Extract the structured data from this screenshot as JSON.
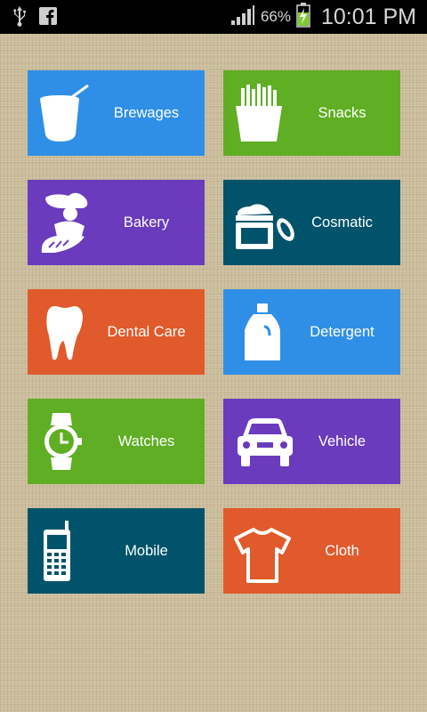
{
  "status_bar": {
    "battery_percent": "66%",
    "time": "10:01 PM",
    "icons": [
      "usb-icon",
      "facebook-icon",
      "signal-icon",
      "battery-charging-icon"
    ]
  },
  "categories": [
    {
      "label": "Brewages",
      "icon": "cup-icon",
      "color": "#2f8fe6"
    },
    {
      "label": "Snacks",
      "icon": "fries-icon",
      "color": "#5fae23"
    },
    {
      "label": "Bakery",
      "icon": "baker-icon",
      "color": "#6a3bbd"
    },
    {
      "label": "Cosmatic",
      "icon": "cream-jar-icon",
      "color": "#00536a"
    },
    {
      "label": "Dental Care",
      "icon": "tooth-icon",
      "color": "#e05a2b"
    },
    {
      "label": "Detergent",
      "icon": "detergent-bottle-icon",
      "color": "#2f8fe6"
    },
    {
      "label": "Watches",
      "icon": "watch-icon",
      "color": "#5fae23"
    },
    {
      "label": "Vehicle",
      "icon": "car-icon",
      "color": "#6a3bbd"
    },
    {
      "label": "Mobile",
      "icon": "mobile-phone-icon",
      "color": "#00536a"
    },
    {
      "label": "Cloth",
      "icon": "tshirt-icon",
      "color": "#e05a2b"
    }
  ]
}
